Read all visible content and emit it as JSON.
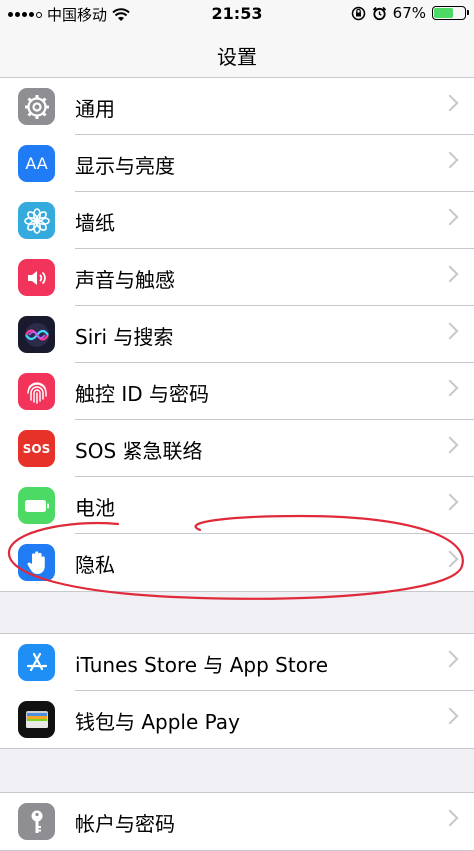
{
  "status_bar": {
    "carrier": "中国移动",
    "time": "21:53",
    "battery": "67%",
    "battery_level": 0.67
  },
  "nav": {
    "title": "设置"
  },
  "group1": [
    {
      "label": "通用",
      "icon": "gear-icon",
      "color": "#8e8e93"
    },
    {
      "label": "显示与亮度",
      "icon": "display-brightness-icon",
      "color": "#1f7cf5"
    },
    {
      "label": "墙纸",
      "icon": "wallpaper-flower-icon",
      "color": "#35aadc"
    },
    {
      "label": "声音与触感",
      "icon": "speaker-icon",
      "color": "#f2335a"
    },
    {
      "label": "Siri 与搜索",
      "icon": "siri-icon",
      "color": "#1a1a2e"
    },
    {
      "label": "触控 ID 与密码",
      "icon": "fingerprint-icon",
      "color": "#f2335a"
    },
    {
      "label": "SOS 紧急联络",
      "icon": "sos-icon",
      "color": "#e63229",
      "icon_text": "SOS"
    },
    {
      "label": "电池",
      "icon": "battery-icon",
      "color": "#4cd964"
    },
    {
      "label": "隐私",
      "icon": "hand-icon",
      "color": "#1f7cf5"
    }
  ],
  "group2": [
    {
      "label": "iTunes Store 与 App Store",
      "icon": "app-store-icon",
      "color": "#1f8ff5"
    },
    {
      "label": "钱包与 Apple Pay",
      "icon": "wallet-icon",
      "color": "#111111"
    }
  ],
  "group3": [
    {
      "label": "帐户与密码",
      "icon": "key-icon",
      "color": "#8e8e93"
    }
  ],
  "icon_text": {
    "aa": "AA"
  },
  "annotation_color": "#e02a3a"
}
